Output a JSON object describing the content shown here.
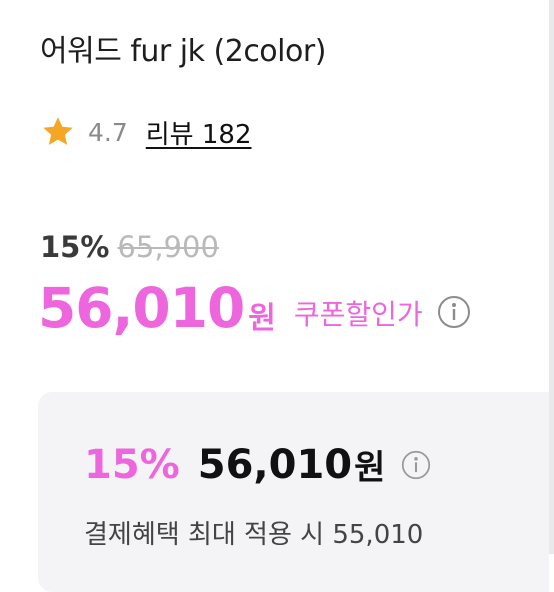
{
  "product": {
    "title": "어워드 fur jk (2color)"
  },
  "rating": {
    "value": "4.7",
    "review_link": "리뷰 182",
    "star_color": "#f5a623"
  },
  "pricing": {
    "discount_percent": "15%",
    "original_price": "65,900",
    "sale_price": "56,010",
    "currency_unit": "원",
    "coupon_label": "쿠폰할인가",
    "accent_color": "#ee66de"
  },
  "benefit": {
    "discount_percent": "15%",
    "price": "56,010",
    "currency_unit": "원",
    "note": "결제혜택 최대 적용 시 55,010"
  },
  "icons": {
    "rating": "star-icon",
    "coupon_info": "info-icon",
    "benefit_info": "info-icon"
  }
}
